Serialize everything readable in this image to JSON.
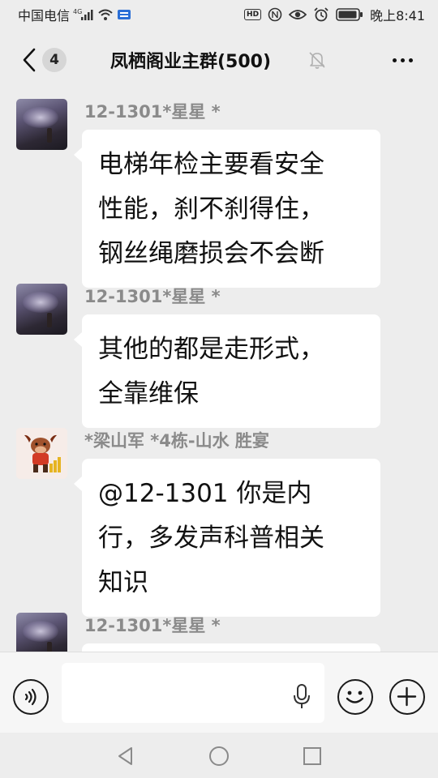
{
  "status_bar": {
    "carrier": "中国电信",
    "network": "4G",
    "hd_label": "HD",
    "time": "晚上8:41",
    "icons": [
      "signal-icon",
      "wifi-icon",
      "sim-icon",
      "hd-icon",
      "nfc-icon",
      "eye-icon",
      "alarm-icon",
      "battery-icon"
    ]
  },
  "header": {
    "unread_count": "4",
    "title": "凤栖阁业主群(500)",
    "muted": true
  },
  "messages": [
    {
      "sender": "12-1301*星星 *",
      "avatar": "starry-avatar",
      "lines": [
        "电梯年检主要看安全",
        "性能，刹不刹得住，",
        "钢丝绳磨损会不会断"
      ]
    },
    {
      "sender": "12-1301*星星 *",
      "avatar": "starry-avatar",
      "lines": [
        "其他的都是走形式，",
        "全靠维保"
      ]
    },
    {
      "sender": "*梁山军 *4栋-山水 胜宴",
      "avatar": "ox-avatar",
      "lines": [
        "@12-1301  你是内",
        "行，多发声科普相关",
        "知识"
      ]
    },
    {
      "sender": "12-1301*星星 *",
      "avatar": "starry-avatar",
      "lines": []
    }
  ],
  "input_bar": {
    "value": "",
    "icons": [
      "voice-icon",
      "mic-icon",
      "emoji-icon",
      "plus-icon"
    ]
  },
  "nav_bar": {
    "icons": [
      "back-triangle-icon",
      "home-circle-icon",
      "recents-square-icon"
    ]
  },
  "colors": {
    "background": "#ededed",
    "bubble": "#ffffff",
    "sender_name": "#8a8a8a",
    "text": "#111111"
  }
}
